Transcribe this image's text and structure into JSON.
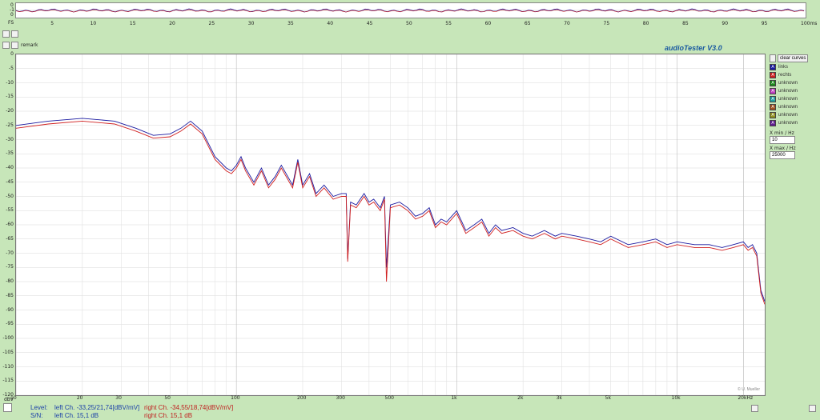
{
  "top_strip": {
    "unit": "FS",
    "ticks": [
      "5",
      "10",
      "15",
      "20",
      "25",
      "30",
      "35",
      "40",
      "45",
      "50",
      "55",
      "60",
      "65",
      "70",
      "75",
      "80",
      "85",
      "90",
      "95",
      "100ms"
    ],
    "y_ticks": [
      "0",
      "-1",
      "0"
    ]
  },
  "controls": {
    "remark_label": "remark",
    "brand": "audioTester  V3.0",
    "watermark": "© U. Mueller"
  },
  "legend": {
    "clear_label": "clear curves",
    "items": [
      {
        "letter": "A",
        "label": "links",
        "color": "#1a1aa0"
      },
      {
        "letter": "A",
        "label": "rechts",
        "color": "#d02020"
      },
      {
        "letter": "A",
        "label": "unknown",
        "color": "#1a8a1a"
      },
      {
        "letter": "A",
        "label": "unknown",
        "color": "#c040c0"
      },
      {
        "letter": "A",
        "label": "unknown",
        "color": "#20a0a0"
      },
      {
        "letter": "A",
        "label": "unknown",
        "color": "#a05020"
      },
      {
        "letter": "A",
        "label": "unknown",
        "color": "#909020"
      },
      {
        "letter": "A",
        "label": "unknown",
        "color": "#602090"
      }
    ],
    "xmin_label": "X min / Hz",
    "xmin_value": "10",
    "xmax_label": "X max / Hz",
    "xmax_value": "25000"
  },
  "status": {
    "level_label": "Level:",
    "left_level": "left Ch. -33,25/21,74[dBV/mV]",
    "right_level": "right Ch. -34,55/18,74[dBV/mV]",
    "sn_label": "S/N:",
    "left_sn": "left Ch. 15,1 dB",
    "right_sn": "right Ch. 15,1 dB"
  },
  "chart_data": {
    "type": "line",
    "xscale": "log",
    "xlim": [
      10,
      25000
    ],
    "ylim": [
      -120,
      0
    ],
    "ylabel": "dBV",
    "grid": true,
    "legend_position": "right",
    "yticks": [
      "0",
      "-5",
      "-10",
      "-15",
      "-20",
      "-25",
      "-30",
      "-35",
      "-40",
      "-45",
      "-50",
      "-55",
      "-60",
      "-65",
      "-70",
      "-75",
      "-80",
      "-85",
      "-90",
      "-95",
      "-100",
      "-105",
      "-110",
      "-115",
      "-120"
    ],
    "xticks": [
      {
        "v": 10,
        "t": "10"
      },
      {
        "v": 20,
        "t": "20"
      },
      {
        "v": 30,
        "t": "30"
      },
      {
        "v": 50,
        "t": "50"
      },
      {
        "v": 100,
        "t": "100"
      },
      {
        "v": 200,
        "t": "200"
      },
      {
        "v": 300,
        "t": "300"
      },
      {
        "v": 500,
        "t": "500"
      },
      {
        "v": 1000,
        "t": "1k"
      },
      {
        "v": 2000,
        "t": "2k"
      },
      {
        "v": 3000,
        "t": "3k"
      },
      {
        "v": 5000,
        "t": "5k"
      },
      {
        "v": 10000,
        "t": "10k"
      },
      {
        "v": 20000,
        "t": "20kHz"
      }
    ],
    "series": [
      {
        "name": "links",
        "color": "#1a1aa0",
        "x": [
          10,
          14,
          20,
          28,
          35,
          42,
          50,
          56,
          62,
          70,
          80,
          90,
          95,
          100,
          105,
          110,
          120,
          130,
          140,
          150,
          160,
          180,
          190,
          200,
          215,
          230,
          250,
          275,
          300,
          315,
          320,
          330,
          350,
          380,
          400,
          420,
          450,
          470,
          480,
          500,
          550,
          600,
          650,
          700,
          750,
          800,
          850,
          900,
          1000,
          1100,
          1200,
          1300,
          1400,
          1500,
          1600,
          1800,
          2000,
          2200,
          2500,
          2800,
          3000,
          3500,
          4000,
          4500,
          5000,
          6000,
          7000,
          8000,
          9000,
          10000,
          12000,
          14000,
          16000,
          18000,
          20000,
          21000,
          22000,
          23000,
          24000,
          25000
        ],
        "y": [
          -25,
          -23.5,
          -22.5,
          -23.5,
          -26,
          -28.5,
          -28,
          -26,
          -23.5,
          -27,
          -36,
          -40,
          -41,
          -39,
          -36,
          -40,
          -45,
          -40,
          -46,
          -43,
          -39,
          -46,
          -37,
          -46,
          -42,
          -49,
          -46,
          -50,
          -49,
          -49,
          -72,
          -52,
          -53,
          -49,
          -52,
          -51,
          -54,
          -50,
          -75,
          -53,
          -52,
          -54,
          -57,
          -56,
          -54,
          -60,
          -58,
          -59,
          -55,
          -62,
          -60,
          -58,
          -63,
          -60,
          -62,
          -61,
          -63,
          -64,
          -62,
          -64,
          -63,
          -64,
          -65,
          -66,
          -64,
          -67,
          -66,
          -65,
          -67,
          -66,
          -67,
          -67,
          -68,
          -67,
          -66,
          -68,
          -67,
          -70,
          -83,
          -87
        ]
      },
      {
        "name": "rechts",
        "color": "#d02020",
        "x": [
          10,
          14,
          20,
          28,
          35,
          42,
          50,
          56,
          62,
          70,
          80,
          90,
          95,
          100,
          105,
          110,
          120,
          130,
          140,
          150,
          160,
          180,
          190,
          200,
          215,
          230,
          250,
          275,
          300,
          315,
          320,
          330,
          350,
          380,
          400,
          420,
          450,
          470,
          480,
          500,
          550,
          600,
          650,
          700,
          750,
          800,
          850,
          900,
          1000,
          1100,
          1200,
          1300,
          1400,
          1500,
          1600,
          1800,
          2000,
          2200,
          2500,
          2800,
          3000,
          3500,
          4000,
          4500,
          5000,
          6000,
          7000,
          8000,
          9000,
          10000,
          12000,
          14000,
          16000,
          18000,
          20000,
          21000,
          22000,
          23000,
          24000,
          25000
        ],
        "y": [
          -26,
          -24.5,
          -23.5,
          -24.5,
          -27,
          -29.5,
          -29,
          -27,
          -24.5,
          -28,
          -37,
          -41,
          -42,
          -40,
          -37,
          -41,
          -46,
          -41,
          -47,
          -44,
          -40,
          -47,
          -38,
          -47,
          -43,
          -50,
          -47,
          -51,
          -50,
          -50,
          -73,
          -53,
          -54,
          -50,
          -53,
          -52,
          -55,
          -51,
          -80,
          -54,
          -53,
          -55,
          -58,
          -57,
          -55,
          -61,
          -59,
          -60,
          -56,
          -63,
          -61,
          -59,
          -64,
          -61,
          -63,
          -62,
          -64,
          -65,
          -63,
          -65,
          -64,
          -65,
          -66,
          -67,
          -65,
          -68,
          -67,
          -66,
          -68,
          -67,
          -68,
          -68,
          -69,
          -68,
          -67,
          -69,
          -68,
          -71,
          -84,
          -88
        ]
      }
    ]
  }
}
